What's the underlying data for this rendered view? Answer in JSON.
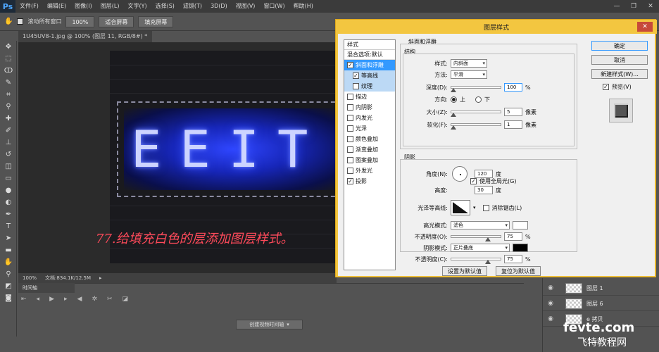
{
  "app": {
    "logo": "Ps"
  },
  "menus": [
    "文件(F)",
    "编辑(E)",
    "图像(I)",
    "图层(L)",
    "文字(Y)",
    "选择(S)",
    "滤镜(T)",
    "3D(D)",
    "视图(V)",
    "窗口(W)",
    "帮助(H)"
  ],
  "options_bar": {
    "scroll_all": "滚动所有窗口",
    "zoom": "100%",
    "fit_screen": "适合屏幕",
    "fill_screen": "填充屏幕"
  },
  "document": {
    "tab_title": "1U45UV8-1.jpg @ 100% (图层 11, RGB/8#) *",
    "zoom": "100%",
    "doc_size": "文档:834.1K/12.5M"
  },
  "canvas": {
    "neon_text": "EEIT",
    "annotation": "77.给填充白色的层添加图层样式。"
  },
  "timeline": {
    "tab": "时间轴",
    "create_button": "创建视频时间轴"
  },
  "layers": [
    {
      "name": "图层 1"
    },
    {
      "name": "图层 6"
    },
    {
      "name": "e 拷贝"
    }
  ],
  "watermark": {
    "line1": "fevte.com",
    "line2": "飞特教程网"
  },
  "dialog": {
    "title": "图层样式",
    "styles_header": "样式",
    "blend_options": "混合选项:默认",
    "styles": [
      {
        "label": "斜面和浮雕",
        "checked": true,
        "selected": true
      },
      {
        "label": "等高线",
        "checked": true,
        "sub": true
      },
      {
        "label": "纹理",
        "checked": false,
        "sub": true
      },
      {
        "label": "描边",
        "checked": false
      },
      {
        "label": "内阴影",
        "checked": false
      },
      {
        "label": "内发光",
        "checked": false
      },
      {
        "label": "光泽",
        "checked": false
      },
      {
        "label": "颜色叠加",
        "checked": false
      },
      {
        "label": "渐变叠加",
        "checked": false
      },
      {
        "label": "图案叠加",
        "checked": false
      },
      {
        "label": "外发光",
        "checked": false
      },
      {
        "label": "投影",
        "checked": true
      }
    ],
    "bevel": {
      "section": "斜面和浮雕",
      "structure": "结构",
      "style_label": "样式:",
      "style_value": "内斜面",
      "technique_label": "方法:",
      "technique_value": "平滑",
      "depth_label": "深度(D):",
      "depth_value": "100",
      "depth_unit": "%",
      "direction_label": "方向:",
      "dir_up": "上",
      "dir_down": "下",
      "size_label": "大小(Z):",
      "size_value": "5",
      "size_unit": "像素",
      "soften_label": "软化(F):",
      "soften_value": "1",
      "soften_unit": "像素"
    },
    "shading": {
      "section": "阴影",
      "angle_label": "角度(N):",
      "angle_value": "120",
      "angle_unit": "度",
      "global_light": "使用全局光(G)",
      "altitude_label": "高度:",
      "altitude_value": "30",
      "altitude_unit": "度",
      "gloss_label": "光泽等高线:",
      "antialias": "消除锯齿(L)",
      "highlight_label": "高光模式:",
      "highlight_value": "滤色",
      "highlight_opacity_label": "不透明度(O):",
      "highlight_opacity_value": "75",
      "pct": "%",
      "shadow_label": "阴影模式:",
      "shadow_value": "正片叠底",
      "shadow_opacity_label": "不透明度(C):",
      "shadow_opacity_value": "75"
    },
    "set_default": "设置为默认值",
    "reset_default": "复位为默认值",
    "ok": "确定",
    "cancel": "取消",
    "new_style": "新建样式(W)...",
    "preview": "预览(V)"
  }
}
